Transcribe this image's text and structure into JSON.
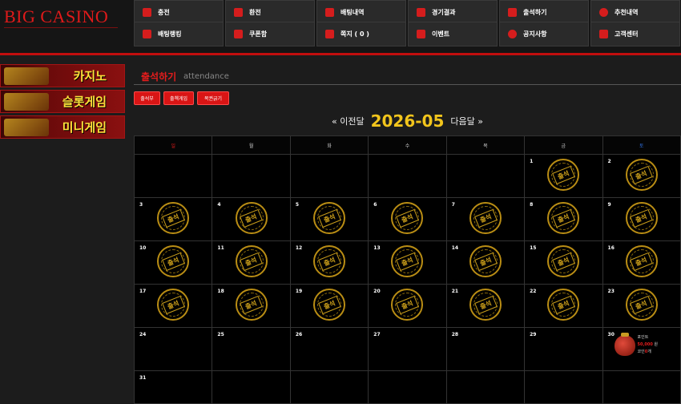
{
  "logo": {
    "text": "BIG CASINO"
  },
  "nav": {
    "row1": [
      {
        "label": "충전",
        "icon": "deposit-icon"
      },
      {
        "label": "환전",
        "icon": "withdraw-icon"
      },
      {
        "label": "배팅내역",
        "icon": "bet-history-icon"
      },
      {
        "label": "경기결과",
        "icon": "match-result-icon"
      },
      {
        "label": "출석하기",
        "icon": "attendance-icon"
      },
      {
        "label": "추천내역",
        "icon": "referral-icon"
      }
    ],
    "row2": [
      {
        "label": "배팅랭킹",
        "icon": "ranking-icon"
      },
      {
        "label": "쿠폰함",
        "icon": "coupon-icon"
      },
      {
        "label": "쪽지 ( 0 )",
        "icon": "message-icon"
      },
      {
        "label": "이벤트",
        "icon": "gift-icon"
      },
      {
        "label": "공지사항",
        "icon": "notice-icon"
      },
      {
        "label": "고객센터",
        "icon": "phone-icon"
      }
    ]
  },
  "sidebar": {
    "banners": [
      {
        "label": "카지노"
      },
      {
        "label": "슬롯게임"
      },
      {
        "label": "미니게임"
      }
    ]
  },
  "page": {
    "title": "출석하기",
    "subtitle": "attendance",
    "buttons": [
      "출석부",
      "출첵게임",
      "복권긁기"
    ]
  },
  "calendar": {
    "prev_label": "« 이전달",
    "month": "2026-05",
    "next_label": "다음달 »",
    "weekdays": [
      "일",
      "월",
      "화",
      "수",
      "목",
      "금",
      "토"
    ],
    "weekday_colors": [
      "#e51c1c",
      "#cccccc",
      "#cccccc",
      "#cccccc",
      "#cccccc",
      "#cccccc",
      "#2f6fe0"
    ],
    "stamp_text": "출석",
    "attended_days": [
      1,
      2,
      3,
      4,
      5,
      6,
      7,
      8,
      9,
      10,
      11,
      12,
      13,
      14,
      15,
      16,
      17,
      18,
      19,
      20,
      21,
      22,
      23
    ],
    "reward": {
      "line1": "포인트",
      "amount": "50,000",
      "unit": "원",
      "coin_label": "코인",
      "coin_value": "0",
      "coin_unit": "개"
    }
  },
  "colors": {
    "accent": "#c10e0e",
    "gold": "#f2c51c"
  }
}
